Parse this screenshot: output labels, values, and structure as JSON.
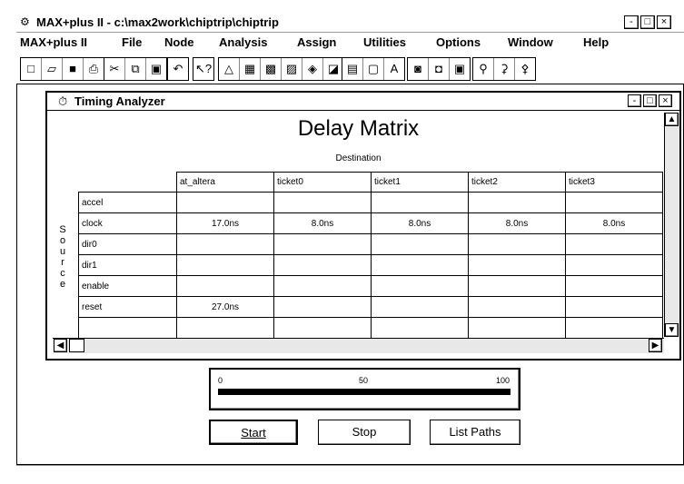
{
  "app": {
    "title": "MAX+plus II - c:\\max2work\\chiptrip\\chiptrip",
    "window_buttons": [
      "-",
      "□",
      "×"
    ]
  },
  "menu": [
    "MAX+plus II",
    "File",
    "Node",
    "Analysis",
    "Assign",
    "Utilities",
    "Options",
    "Window",
    "Help"
  ],
  "toolbar": {
    "groups": [
      [
        "new-icon",
        "open-icon",
        "save-icon",
        "print-icon"
      ],
      [
        "cut-icon",
        "copy-icon",
        "paste-icon"
      ],
      [
        "undo-icon"
      ],
      [
        "help-icon"
      ],
      [
        "hierarchy-icon",
        "floorplan-icon",
        "compiler-icon",
        "simulator-icon",
        "timing-icon",
        "programmer-icon"
      ],
      [
        "graphic-editor-icon",
        "symbol-editor-icon",
        "text-editor-icon"
      ],
      [
        "waveform-icon",
        "save-check-icon",
        "save-compile-icon"
      ],
      [
        "s1-icon",
        "s2-icon",
        "s3-icon"
      ]
    ]
  },
  "timing_window": {
    "title": "Timing Analyzer",
    "window_buttons": [
      "-",
      "□",
      "×"
    ],
    "heading": "Delay Matrix",
    "destination_label": "Destination",
    "source_label": "Source",
    "columns": [
      "at_altera",
      "ticket0",
      "ticket1",
      "ticket2",
      "ticket3"
    ],
    "rows": [
      {
        "name": "accel",
        "cells": [
          "",
          "",
          "",
          "",
          ""
        ]
      },
      {
        "name": "clock",
        "cells": [
          "17.0ns",
          "8.0ns",
          "8.0ns",
          "8.0ns",
          "8.0ns"
        ]
      },
      {
        "name": "dir0",
        "cells": [
          "",
          "",
          "",
          "",
          ""
        ]
      },
      {
        "name": "dir1",
        "cells": [
          "",
          "",
          "",
          "",
          ""
        ]
      },
      {
        "name": "enable",
        "cells": [
          "",
          "",
          "",
          "",
          ""
        ]
      },
      {
        "name": "reset",
        "cells": [
          "27.0ns",
          "",
          "",
          "",
          ""
        ]
      },
      {
        "name": "",
        "cells": [
          "",
          "",
          "",
          "",
          ""
        ]
      }
    ],
    "progress": {
      "ticks": [
        "0",
        "50",
        "100"
      ],
      "value": 100
    },
    "buttons": {
      "start": "Start",
      "stop": "Stop",
      "list_paths": "List Paths"
    }
  }
}
